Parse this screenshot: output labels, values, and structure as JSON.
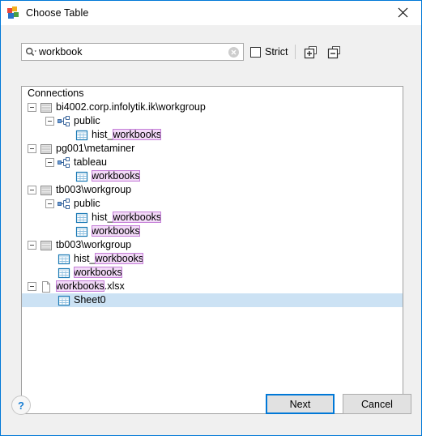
{
  "window": {
    "title": "Choose Table",
    "app_icon": "colored-blocks-icon",
    "close_label": "✕"
  },
  "search": {
    "icon": "search-dropdown-icon",
    "value": "workbook",
    "placeholder": "",
    "clear_icon": "clear-circle-icon",
    "strict_label": "Strict",
    "strict_checked": false,
    "expand_all_icon": "expand-all-icon",
    "collapse_all_icon": "collapse-all-icon"
  },
  "tree": {
    "header": "Connections",
    "nodes": [
      {
        "label": "bi4002.corp.infolytik.ik\\workgroup",
        "icon": "server-icon",
        "depth": 0,
        "expanded": true,
        "match": null,
        "selected": false
      },
      {
        "label": "public",
        "icon": "schema-icon",
        "depth": 1,
        "expanded": true,
        "match": null,
        "selected": false
      },
      {
        "label": "hist_workbooks",
        "icon": "table-icon",
        "depth": 2,
        "expanded": null,
        "match": "workbooks",
        "selected": false
      },
      {
        "label": "pg001\\metaminer",
        "icon": "server-icon",
        "depth": 0,
        "expanded": true,
        "match": null,
        "selected": false
      },
      {
        "label": "tableau",
        "icon": "schema-icon",
        "depth": 1,
        "expanded": true,
        "match": null,
        "selected": false
      },
      {
        "label": "workbooks",
        "icon": "table-icon",
        "depth": 2,
        "expanded": null,
        "match": "workbooks",
        "selected": false
      },
      {
        "label": "tb003\\workgroup",
        "icon": "server-icon",
        "depth": 0,
        "expanded": true,
        "match": null,
        "selected": false
      },
      {
        "label": "public",
        "icon": "schema-icon",
        "depth": 1,
        "expanded": true,
        "match": null,
        "selected": false
      },
      {
        "label": "hist_workbooks",
        "icon": "table-icon",
        "depth": 2,
        "expanded": null,
        "match": "workbooks",
        "selected": false
      },
      {
        "label": "workbooks",
        "icon": "table-icon",
        "depth": 2,
        "expanded": null,
        "match": "workbooks",
        "selected": false
      },
      {
        "label": "tb003\\workgroup",
        "icon": "server-icon",
        "depth": 0,
        "expanded": true,
        "match": null,
        "selected": false
      },
      {
        "label": "hist_workbooks",
        "icon": "table-icon",
        "depth": 1,
        "expanded": null,
        "match": "workbooks",
        "selected": false
      },
      {
        "label": "workbooks",
        "icon": "table-icon",
        "depth": 1,
        "expanded": null,
        "match": "workbooks",
        "selected": false
      },
      {
        "label": "workbooks.xlsx",
        "icon": "file-icon",
        "depth": 0,
        "expanded": true,
        "match": "workbooks",
        "selected": false
      },
      {
        "label": "Sheet0",
        "icon": "table-icon",
        "depth": 1,
        "expanded": null,
        "match": null,
        "selected": true
      }
    ]
  },
  "footer": {
    "help_label": "?",
    "next_label": "Next",
    "cancel_label": "Cancel"
  },
  "colors": {
    "accent": "#0078d7",
    "selection": "#cce2f4",
    "match_highlight": "#f2d9f7",
    "match_border": "#c57fd8",
    "dialog_bg": "#f0f0f0"
  }
}
